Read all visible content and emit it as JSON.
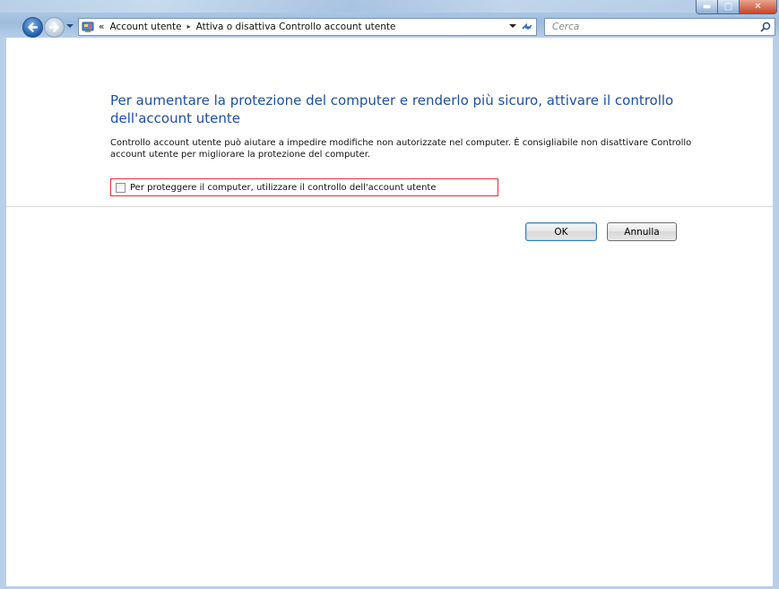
{
  "window": {
    "controls": {
      "minimize_icon": "minimize-icon",
      "maximize_icon": "maximize-icon",
      "close_icon": "close-icon"
    }
  },
  "nav": {
    "back_icon": "back-arrow-icon",
    "forward_icon": "forward-arrow-icon",
    "breadcrumb_prefix": "«",
    "breadcrumbs": [
      "Account utente",
      "Attiva o disattiva Controllo account utente"
    ],
    "separator": "▸"
  },
  "search": {
    "placeholder": "Cerca"
  },
  "main": {
    "heading": "Per aumentare la protezione del computer e renderlo più sicuro, attivare il controllo dell'account utente",
    "description": "Controllo account utente può aiutare a impedire modifiche non autorizzate nel computer. È consigliabile non disattivare Controllo account utente per migliorare la protezione del computer.",
    "checkbox_label": "Per proteggere il computer, utilizzare il controllo dell'account utente",
    "checkbox_checked": false
  },
  "buttons": {
    "ok": "OK",
    "cancel": "Annulla"
  },
  "colors": {
    "heading": "#1f4fa0",
    "highlight_border": "#e0303a",
    "frame": "#b8cfe8"
  }
}
